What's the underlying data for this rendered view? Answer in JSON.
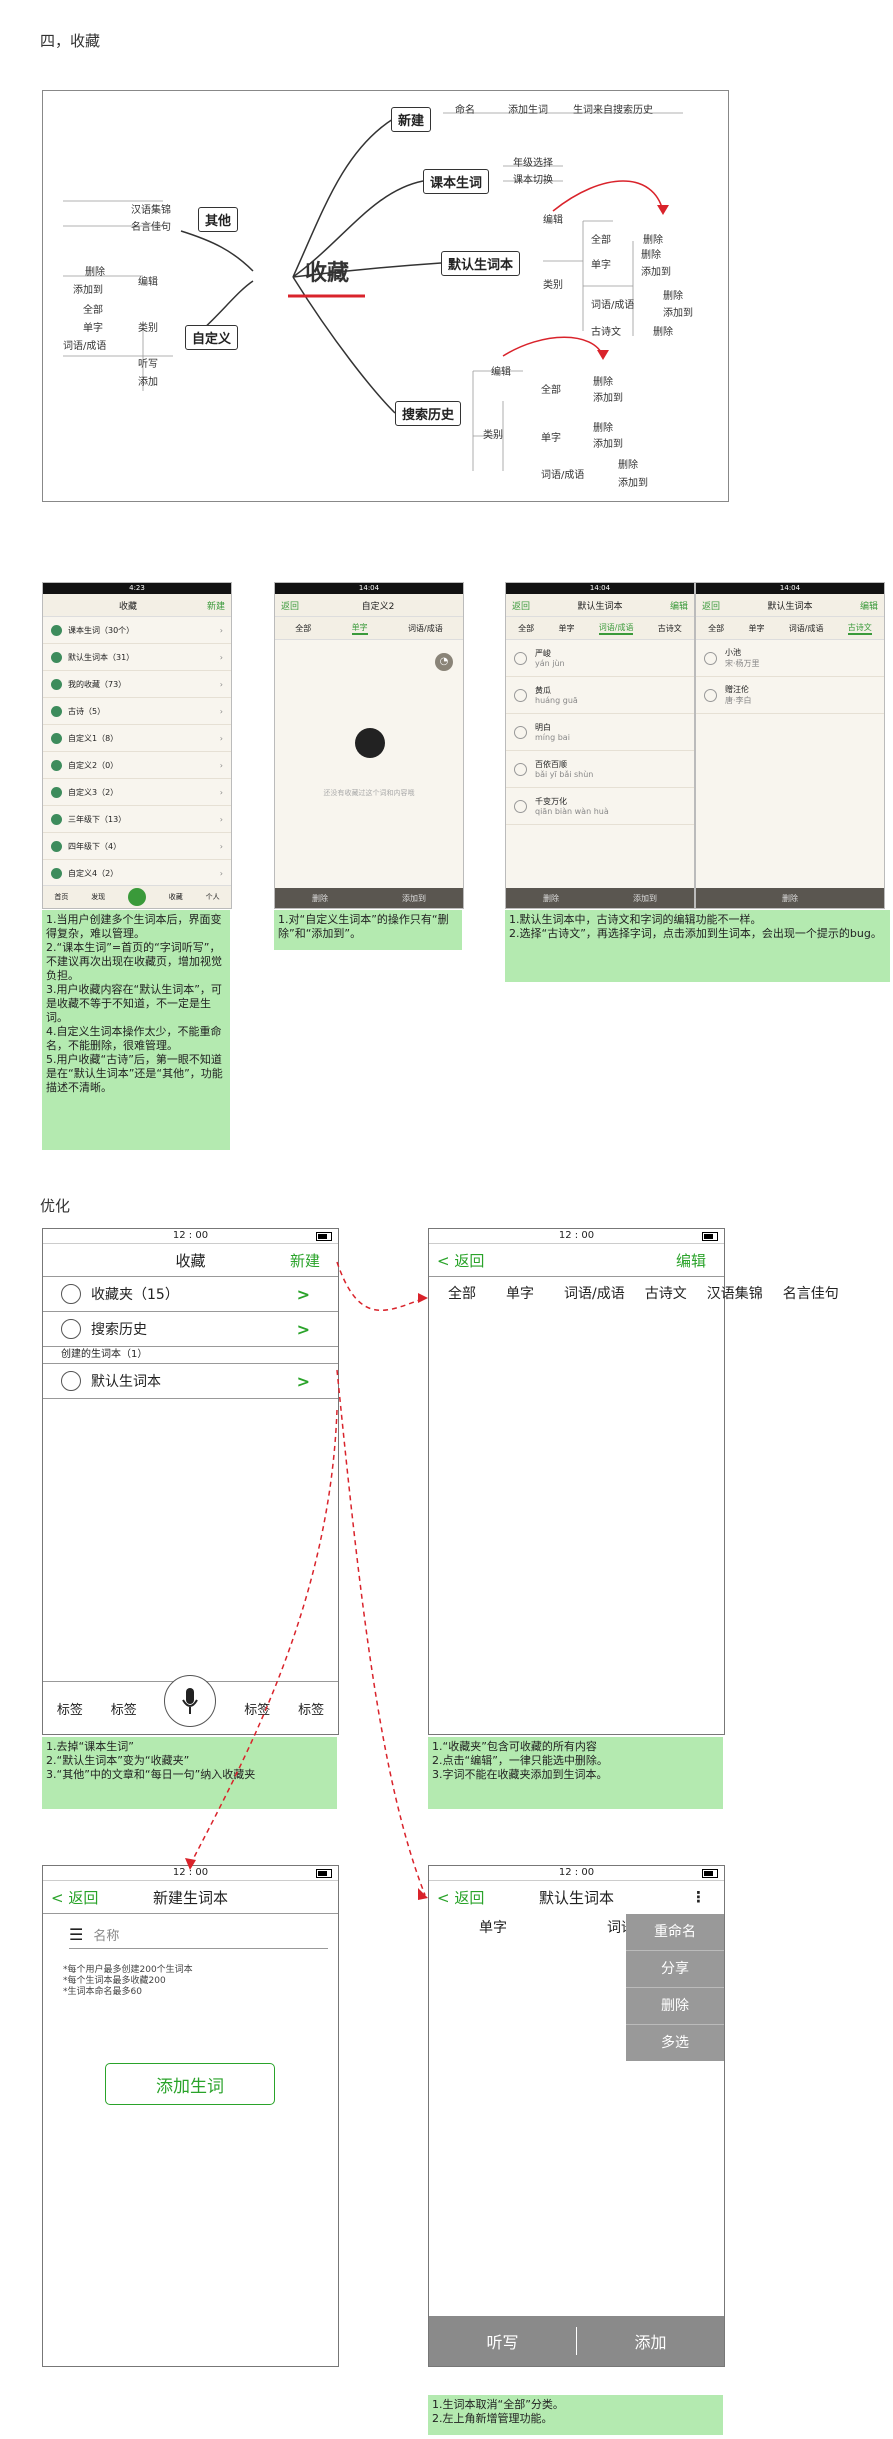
{
  "section1_title": "四，收藏",
  "mindmap": {
    "root": "收藏",
    "nodes": {
      "new": "新建",
      "course": "课本生词",
      "default": "默认生词本",
      "history": "搜索历史",
      "other": "其他",
      "custom": "自定义"
    },
    "new_leaves": [
      "命名",
      "添加生词",
      "生词来自搜索历史"
    ],
    "course_leaves": [
      "年级选择",
      "课本切换"
    ],
    "default_leaves": [
      "编辑",
      "类别",
      "全部",
      "删除",
      "单字",
      "删除",
      "添加到",
      "词语/成语",
      "删除",
      "添加到",
      "古诗文",
      "删除"
    ],
    "history_leaves": [
      "编辑",
      "全部",
      "删除",
      "添加到",
      "类别",
      "单字",
      "删除",
      "添加到",
      "词语/成语",
      "删除",
      "添加到"
    ],
    "other_leaves": [
      "汉语集锦",
      "名言佳句"
    ],
    "custom_leaves": [
      "删除",
      "编辑",
      "添加到",
      "全部",
      "单字",
      "类别",
      "词语/成语",
      "听写",
      "添加"
    ]
  },
  "mock1": {
    "nav_left": "",
    "nav_title": "收藏",
    "nav_right": "新建",
    "rows": [
      "课本生词（30个）",
      "默认生词本（31）",
      "我的收藏（73）",
      "古诗（5）",
      "自定义1（8）",
      "自定义2（0）",
      "自定义3（2）",
      "三年级下（13）",
      "四年级下（4）",
      "自定义4（2）"
    ],
    "tabbar": [
      "首页",
      "发现",
      "",
      "收藏",
      "个人"
    ]
  },
  "mock2": {
    "nav_left": "返回",
    "nav_title": "自定义2",
    "tabs": [
      "全部",
      "单字",
      "词语/成语"
    ],
    "empty_text": "还没有收藏过这个词和内容哦",
    "bottom": [
      "删除",
      "添加到"
    ]
  },
  "mock3": {
    "nav_left": "返回",
    "nav_title": "默认生词本",
    "nav_right": "编辑",
    "tabs_a": [
      "全部",
      "单字",
      "词语/成语",
      "古诗文"
    ],
    "tabs_b": [
      "全部",
      "单字",
      "词语/成语",
      "古诗文"
    ],
    "items_a": [
      {
        "w": "严峻",
        "p": "yán jùn"
      },
      {
        "w": "黄瓜",
        "p": "huáng guā"
      },
      {
        "w": "明白",
        "p": "míng bai"
      },
      {
        "w": "百依百顺",
        "p": "bǎi yī bǎi shùn"
      },
      {
        "w": "千变万化",
        "p": "qiān biàn wàn huà"
      }
    ],
    "items_b": [
      {
        "w": "小池",
        "p": "宋·杨万里"
      },
      {
        "w": "赠汪伦",
        "p": "唐·李白"
      }
    ],
    "bottom_a": [
      "删除",
      "添加到"
    ],
    "bottom_b": [
      "删除"
    ]
  },
  "notes_top": {
    "n1": [
      "1.当用户创建多个生词本后，界面变得复杂，难以管理。",
      "2.“课本生词”=首页的“字词听写”，不建议再次出现在收藏页，增加视觉负担。",
      "3.用户收藏内容在“默认生词本”，可是收藏不等于不知道，不一定是生词。",
      "4.自定义生词本操作太少，不能重命名，不能删除，很难管理。",
      "5.用户收藏“古诗”后，第一眼不知道是在“默认生词本”还是“其他”，功能描述不清晰。"
    ],
    "n2": [
      "1.对“自定义生词本”的操作只有“删除”和“添加到”。"
    ],
    "n3": [
      "1.默认生词本中，古诗文和字词的编辑功能不一样。",
      "2.选择“古诗文”，再选择字词，点击添加到生词本，会出现一个提示的bug。"
    ]
  },
  "section2_title": "优化",
  "wf1": {
    "time": "12 : 00",
    "title": "收藏",
    "right": "新建",
    "rows": [
      "收藏夹（15）",
      "搜索历史"
    ],
    "sub": "创建的生词本（1）",
    "rows2": [
      "默认生词本"
    ],
    "tags": [
      "标签",
      "标签",
      "标签",
      "标签"
    ]
  },
  "wf2": {
    "time": "12 : 00",
    "back": "返回",
    "right": "编辑",
    "tabs": [
      "全部",
      "单字",
      "词语/成语",
      "古诗文",
      "汉语集锦",
      "名言佳句"
    ]
  },
  "wf3": {
    "time": "12 : 00",
    "back": "返回",
    "title": "新建生词本",
    "name_placeholder": "名称",
    "rules": [
      "*每个用户最多创建200个生词本",
      "*每个生词本最多收藏200",
      "*生词本命名最多60"
    ],
    "button": "添加生词"
  },
  "wf4": {
    "time": "12 : 00",
    "back": "返回",
    "title": "默认生词本",
    "tabs": [
      "单字",
      "词语/成语"
    ],
    "menu": [
      "重命名",
      "分享",
      "删除",
      "多选"
    ],
    "bottom": [
      "听写",
      "添加"
    ]
  },
  "notes_bottom": {
    "n1": [
      "1.去掉“课本生词”",
      "2.“默认生词本”变为“收藏夹”",
      "3.“其他”中的文章和“每日一句”纳入收藏夹"
    ],
    "n2": [
      "1.“收藏夹”包含可收藏的所有内容",
      "2.点击“编辑”，一律只能选中删除。",
      "3.字词不能在收藏夹添加到生词本。"
    ],
    "n3": [
      "1.生词本取消“全部”分类。",
      "2.左上角新增管理功能。"
    ]
  }
}
